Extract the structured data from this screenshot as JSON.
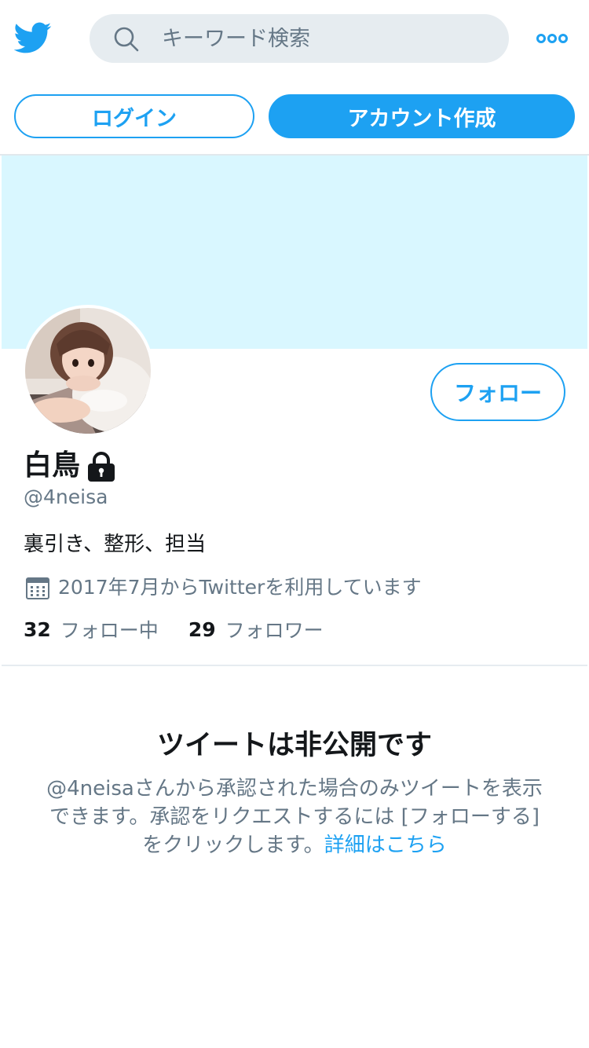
{
  "header": {
    "logo_icon": "twitter-bird-icon",
    "search": {
      "placeholder": "キーワード検索",
      "icon": "search-icon"
    },
    "more_icon": "more-options-icon"
  },
  "auth": {
    "login_label": "ログイン",
    "signup_label": "アカウント作成"
  },
  "colors": {
    "accent": "#1da1f2",
    "banner": "#d9f7ff",
    "secondary_text": "#657786",
    "primary_text": "#14171a",
    "search_bg": "#e6ecf0"
  },
  "profile": {
    "follow_label": "フォロー",
    "name": "白鳥",
    "protected_icon": "lock-icon",
    "handle": "@4neisa",
    "bio": "裏引き、整形、担当",
    "joined_icon": "calendar-icon",
    "joined": "2017年7月からTwitterを利用しています",
    "following_count": "32",
    "following_label": "フォロー中",
    "followers_count": "29",
    "followers_label": "フォロワー"
  },
  "protected_notice": {
    "title": "ツイートは非公開です",
    "message_line1": "@4neisaさんから承認された場合のみツイートを表示",
    "message_line2": "できます。承認をリクエストするには [フォローする]",
    "message_line3": "をクリックします。",
    "link_label": "詳細はこちら"
  }
}
